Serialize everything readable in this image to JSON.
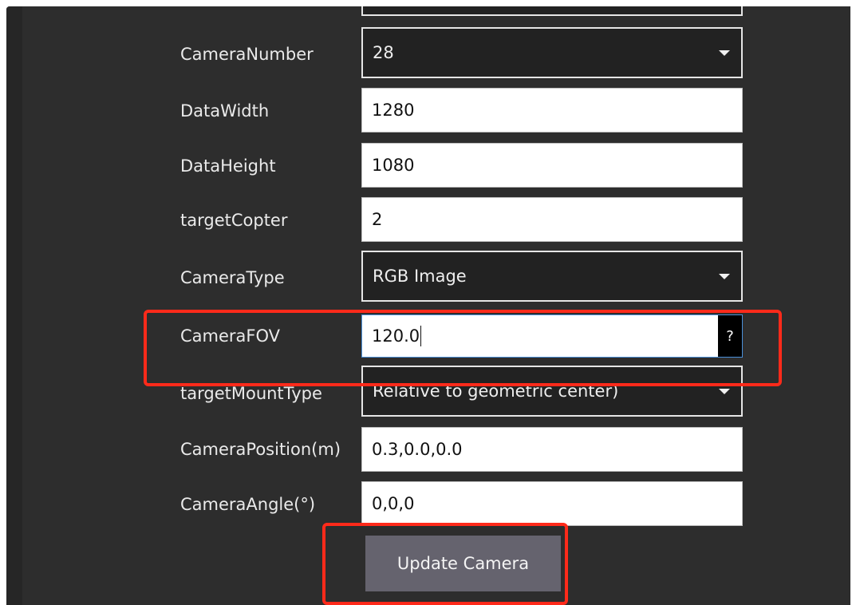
{
  "form": {
    "rows": [
      {
        "label": "CameraNumber",
        "value": "28",
        "kind": "select"
      },
      {
        "label": "DataWidth",
        "value": "1280",
        "kind": "text"
      },
      {
        "label": "DataHeight",
        "value": "1080",
        "kind": "text"
      },
      {
        "label": "targetCopter",
        "value": "2",
        "kind": "text"
      },
      {
        "label": "CameraType",
        "value": "RGB Image",
        "kind": "select"
      },
      {
        "label": "CameraFOV",
        "value": "120.0",
        "kind": "text",
        "help": "?"
      },
      {
        "label": "targetMountType",
        "value": "Relative to geometric center)",
        "kind": "select"
      },
      {
        "label": "CameraPosition(m)",
        "value": "0.3,0.0,0.0",
        "kind": "text"
      },
      {
        "label": "CameraAngle(°)",
        "value": "0,0,0",
        "kind": "text"
      }
    ],
    "update_button": "Update Camera"
  },
  "colors": {
    "panel_bg": "#2d2d2d",
    "highlight": "#ff2a1a",
    "button_bg": "#65636e"
  }
}
